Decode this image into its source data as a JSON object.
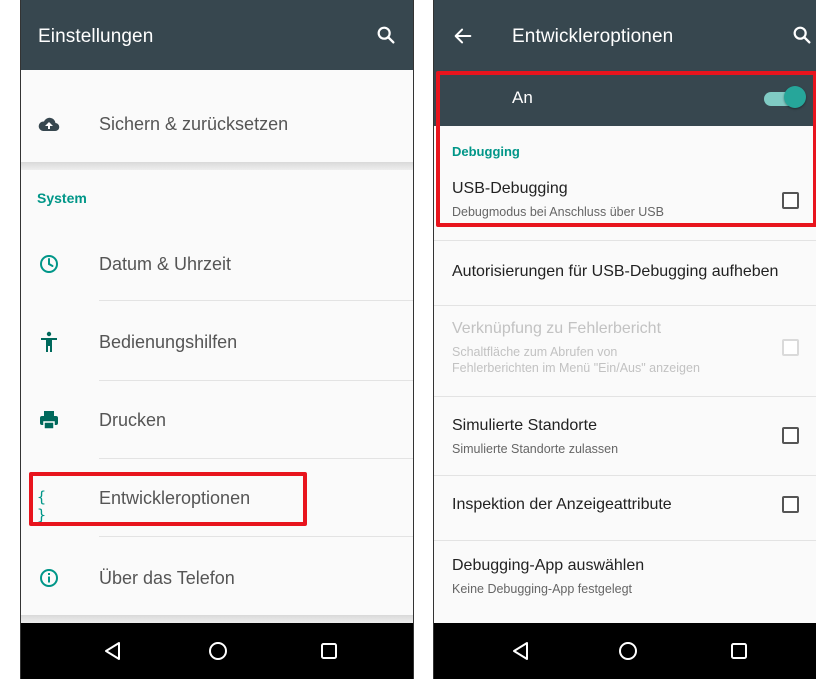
{
  "left_screen": {
    "title": "Einstellungen",
    "top_item": {
      "label": "Sichern & zurücksetzen",
      "icon": "cloud-upload-icon"
    },
    "section_header": "System",
    "items": [
      {
        "label": "Datum & Uhrzeit",
        "icon": "clock-icon"
      },
      {
        "label": "Bedienungshilfen",
        "icon": "accessibility-icon"
      },
      {
        "label": "Drucken",
        "icon": "printer-icon"
      },
      {
        "label": "Entwickleroptionen",
        "icon": "{ }"
      },
      {
        "label": "Über das Telefon",
        "icon": "info-icon"
      }
    ],
    "highlighted_item": "Entwickleroptionen"
  },
  "right_screen": {
    "title": "Entwickleroptionen",
    "master_switch": {
      "label": "An",
      "state": "on"
    },
    "section_header": "Debugging",
    "prefs": [
      {
        "title": "USB-Debugging",
        "summary": "Debugmodus bei Anschluss über USB",
        "checked": false
      },
      {
        "title": "Autorisierungen für USB-Debugging aufheben",
        "summary": ""
      },
      {
        "title": "Verknüpfung zu Fehlerbericht",
        "summary_line1": "Schaltfläche zum Abrufen von",
        "summary_line2": "Fehlerberichten im Menü \"Ein/Aus\" anzeigen",
        "checked": false,
        "enabled": false
      },
      {
        "title": "Simulierte Standorte",
        "summary": "Simulierte Standorte zulassen",
        "checked": false
      },
      {
        "title": "Inspektion der Anzeigeattribute",
        "summary": "",
        "checked": false
      },
      {
        "title": "Debugging-App auswählen",
        "summary": "Keine Debugging-App festgelegt"
      }
    ]
  },
  "colors": {
    "appbar": "#37474f",
    "accent": "#009688",
    "highlight": "#e8141d",
    "navbar": "#000000"
  }
}
